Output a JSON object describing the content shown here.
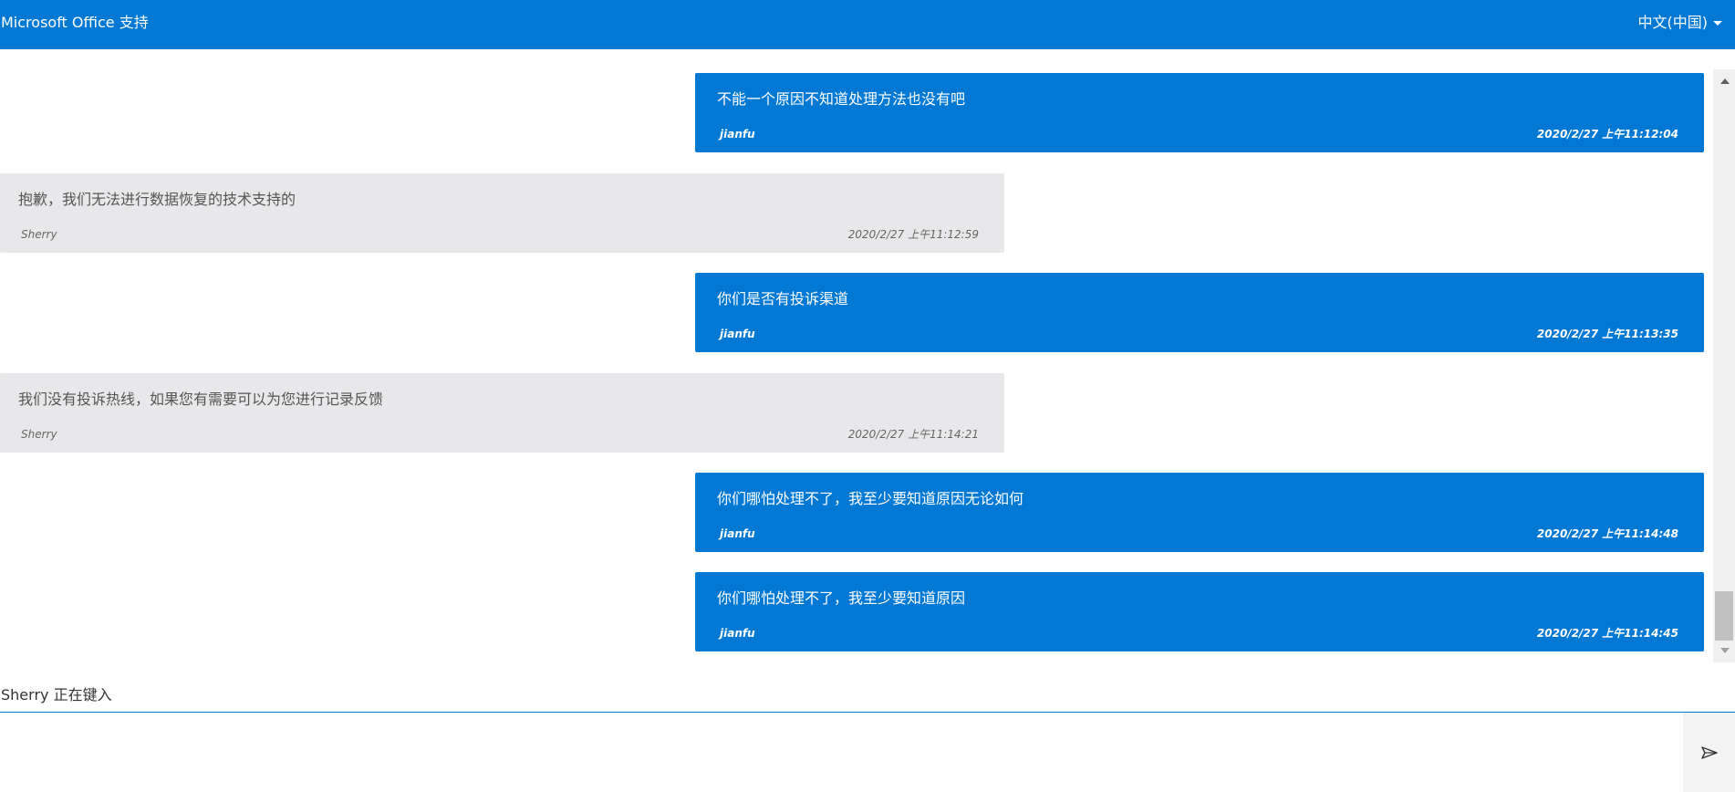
{
  "header": {
    "title": "Microsoft Office 支持",
    "language": "中文(中国)"
  },
  "messages": [
    {
      "role": "user",
      "text": "不能一个原因不知道处理方法也没有吧",
      "sender": "jianfu",
      "time": "2020/2/27 上午11:12:04"
    },
    {
      "role": "agent",
      "text": "抱歉，我们无法进行数据恢复的技术支持的",
      "sender": "Sherry",
      "time": "2020/2/27 上午11:12:59"
    },
    {
      "role": "user",
      "text": "你们是否有投诉渠道",
      "sender": "jianfu",
      "time": "2020/2/27 上午11:13:35"
    },
    {
      "role": "agent",
      "text": "我们没有投诉热线，如果您有需要可以为您进行记录反馈",
      "sender": "Sherry",
      "time": "2020/2/27 上午11:14:21"
    },
    {
      "role": "user",
      "text": "你们哪怕处理不了，我至少要知道原因无论如何",
      "sender": "jianfu",
      "time": "2020/2/27 上午11:14:48"
    },
    {
      "role": "user",
      "text": "你们哪怕处理不了，我至少要知道原因",
      "sender": "jianfu",
      "time": "2020/2/27 上午11:14:45"
    }
  ],
  "status": {
    "typing": "Sherry 正在键入"
  },
  "composer": {
    "value": "",
    "placeholder": ""
  },
  "icons": {
    "send": "send-icon",
    "language_caret": "chevron-down-icon"
  },
  "colors": {
    "brand": "#0078d4",
    "agent_bubble": "#e8e8ea"
  }
}
